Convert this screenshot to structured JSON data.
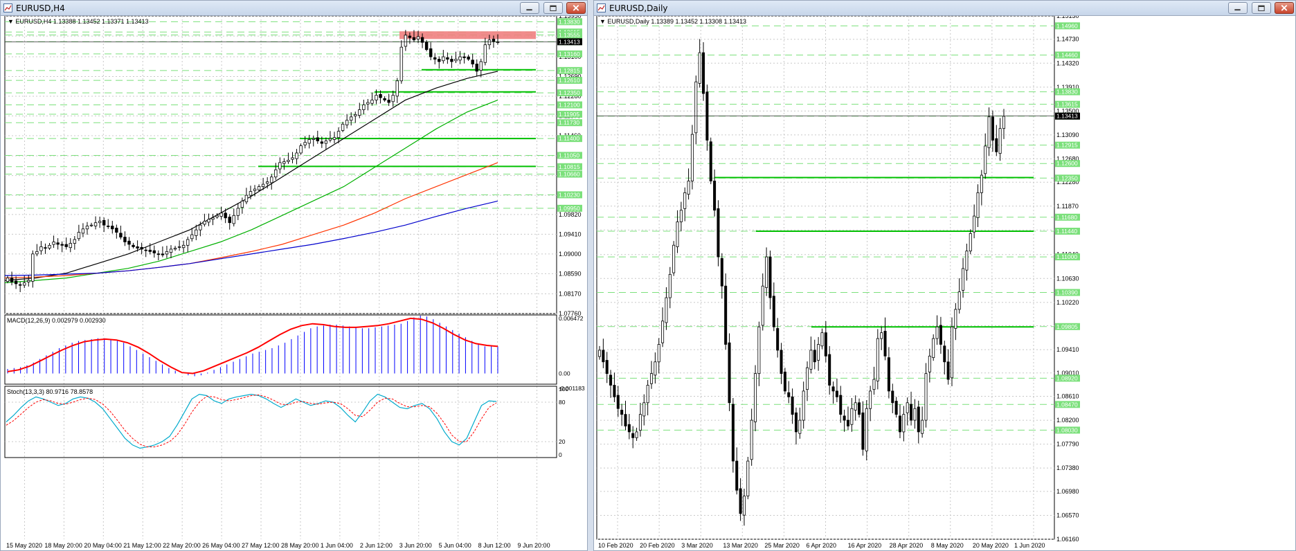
{
  "colors": {
    "background": "#ffffff",
    "grid": "#c8c8c8",
    "candle_border": "#000000",
    "candle_bull": "#ffffff",
    "candle_bear": "#000000",
    "level_lines": "#7be07b",
    "level_labels_bg": "#7be07b",
    "resistance_zone": "#f08080",
    "support_lines": "#00c000",
    "ma_black": "#000000",
    "ma_green": "#00b000",
    "ma_red": "#ff3300",
    "ma_blue": "#0000cc",
    "macd_hist": "#0000ff",
    "macd_signal": "#ff0000",
    "stoch_main": "#00aacc",
    "stoch_signal": "#ff0000",
    "titlebar": "#c7d6ea"
  },
  "windows": [
    {
      "title": "EURUSD,H4",
      "icon": "chart-window-icon",
      "buttons": [
        "minimize-icon",
        "restore-icon",
        "close-icon"
      ]
    },
    {
      "title": "EURUSD,Daily",
      "icon": "chart-window-icon",
      "buttons": [
        "minimize-icon",
        "restore-icon",
        "close-icon"
      ]
    }
  ],
  "chart_data": [
    {
      "type": "candlestick",
      "symbol_header": "EURUSD,H4  1.13388 1.13452 1.13371 1.13413",
      "ylim": [
        1.0776,
        1.1395
      ],
      "price_ticks": [
        "1.13950",
        "1.13530",
        "1.13100",
        "1.12690",
        "1.12280",
        "1.11870",
        "1.11460",
        "1.11040",
        "1.10630",
        "1.10220",
        "1.09820",
        "1.09410",
        "1.09000",
        "1.08590",
        "1.08170",
        "1.07760"
      ],
      "price_ticks_values": [
        1.1395,
        1.1353,
        1.131,
        1.1269,
        1.1228,
        1.1187,
        1.1146,
        1.1104,
        1.1063,
        1.1022,
        1.0982,
        1.0941,
        1.09,
        1.0859,
        1.0817,
        1.0776
      ],
      "level_labels": [
        "1.13830",
        "1.13615",
        "1.13555",
        "1.13413",
        "1.13160",
        "1.12815",
        "1.12610",
        "1.12350",
        "1.12100",
        "1.11905",
        "1.11730",
        "1.11400",
        "1.11050",
        "1.10815",
        "1.10660",
        "1.10230",
        "1.09950"
      ],
      "level_values": [
        1.1383,
        1.13615,
        1.13555,
        1.13413,
        1.1316,
        1.12815,
        1.1261,
        1.1235,
        1.121,
        1.11905,
        1.1173,
        1.114,
        1.1105,
        1.10815,
        1.1066,
        1.1023,
        1.0995
      ],
      "current_price": "1.13413",
      "resistance_zone": [
        1.1347,
        1.1363
      ],
      "support_lines": [
        1.1283,
        1.1237,
        1.114,
        1.1082
      ],
      "x_labels": [
        "15 May 2020",
        "18 May 20:00",
        "20 May 04:00",
        "21 May 12:00",
        "22 May 20:00",
        "26 May 04:00",
        "27 May 12:00",
        "28 May 20:00",
        "1 Jun 04:00",
        "2 Jun 12:00",
        "3 Jun 20:00",
        "5 Jun 04:00",
        "8 Jun 12:00",
        "9 Jun 20:00"
      ],
      "closes": [
        1.085,
        1.0842,
        1.0838,
        1.0835,
        1.084,
        1.0845,
        1.09,
        1.0905,
        1.0915,
        1.0912,
        1.0918,
        1.0925,
        1.092,
        1.0918,
        1.0915,
        1.0922,
        1.093,
        1.0945,
        1.0952,
        1.0958,
        1.096,
        1.0965,
        1.0968,
        1.096,
        1.0958,
        1.0952,
        1.0945,
        1.0935,
        1.0925,
        1.092,
        1.0915,
        1.0912,
        1.091,
        1.0908,
        1.0905,
        1.0902,
        1.09,
        1.0898,
        1.0905,
        1.091,
        1.0912,
        1.0915,
        1.0918,
        1.093,
        1.094,
        1.095,
        1.096,
        1.0968,
        1.0972,
        1.0975,
        1.098,
        1.0985,
        1.0975,
        1.0965,
        1.098,
        1.0995,
        1.101,
        1.1022,
        1.103,
        1.1035,
        1.104,
        1.1045,
        1.105,
        1.106,
        1.1075,
        1.109,
        1.1092,
        1.1095,
        1.11,
        1.111,
        1.1125,
        1.1132,
        1.1138,
        1.114,
        1.1135,
        1.113,
        1.1135,
        1.114,
        1.1142,
        1.1155,
        1.117,
        1.1178,
        1.1185,
        1.119,
        1.12,
        1.121,
        1.1215,
        1.122,
        1.123,
        1.1225,
        1.122,
        1.1215,
        1.123,
        1.126,
        1.133,
        1.1355,
        1.135,
        1.1345,
        1.1352,
        1.134,
        1.1325,
        1.131,
        1.1305,
        1.13,
        1.131,
        1.1305,
        1.13,
        1.1305,
        1.131,
        1.1308,
        1.1305,
        1.1295,
        1.128,
        1.13,
        1.1335,
        1.1345,
        1.1342,
        1.1341
      ],
      "moving_averages": [
        {
          "color": "#000000",
          "values": [
            1.0845,
            1.085,
            1.086,
            1.088,
            1.09,
            1.0925,
            1.095,
            1.0985,
            1.102,
            1.106,
            1.11,
            1.114,
            1.118,
            1.122,
            1.1245,
            1.1265,
            1.128
          ]
        },
        {
          "color": "#00b000",
          "values": [
            1.084,
            1.0845,
            1.085,
            1.086,
            1.087,
            1.0885,
            1.0905,
            1.0925,
            1.095,
            1.098,
            1.101,
            1.104,
            1.108,
            1.112,
            1.116,
            1.1195,
            1.122
          ]
        },
        {
          "color": "#ff3300",
          "values": [
            1.085,
            1.0852,
            1.0855,
            1.086,
            1.0865,
            1.0872,
            1.088,
            1.0892,
            1.0905,
            1.092,
            1.094,
            1.096,
            1.0985,
            1.1015,
            1.104,
            1.1065,
            1.109
          ]
        },
        {
          "color": "#0000cc",
          "values": [
            1.0855,
            1.0856,
            1.0858,
            1.086,
            1.0865,
            1.0872,
            1.088,
            1.089,
            1.09,
            1.091,
            1.092,
            1.0932,
            1.0945,
            1.096,
            1.0978,
            1.0995,
            1.101
          ]
        }
      ],
      "macd": {
        "label": "MACD(12,26,9) 0.002979 0.002930",
        "top_label": "0.006472",
        "zero_label": "0.00",
        "bottom_label": "-0.001183",
        "ylim": [
          -0.001183,
          0.006472
        ],
        "hist": [
          0.0005,
          0.0006,
          0.0007,
          0.0009,
          0.0012,
          0.0016,
          0.002,
          0.0024,
          0.0028,
          0.0031,
          0.0034,
          0.0036,
          0.0037,
          0.0038,
          0.0039,
          0.0039,
          0.0038,
          0.0036,
          0.0034,
          0.003,
          0.0026,
          0.0022,
          0.0018,
          0.0014,
          0.001,
          0.0006,
          0.0003,
          0.0,
          -0.0002,
          -0.0003,
          -0.0002,
          0.0001,
          0.0004,
          0.0007,
          0.001,
          0.0013,
          0.0016,
          0.0019,
          0.0022,
          0.0024,
          0.0026,
          0.0028,
          0.0031,
          0.0034,
          0.0038,
          0.0042,
          0.0046,
          0.005,
          0.0052,
          0.0053,
          0.0054,
          0.0054,
          0.0053,
          0.0052,
          0.0051,
          0.005,
          0.005,
          0.0051,
          0.0052,
          0.0053,
          0.0054,
          0.0055,
          0.0058,
          0.0062,
          0.0064,
          0.0063,
          0.006,
          0.0056,
          0.0052,
          0.0048,
          0.0044,
          0.004,
          0.0036,
          0.0033,
          0.003,
          0.003,
          0.003
        ],
        "signal": [
          0.0002,
          0.0004,
          0.0008,
          0.0014,
          0.002,
          0.0026,
          0.0031,
          0.0035,
          0.0037,
          0.0038,
          0.0037,
          0.0034,
          0.0029,
          0.0022,
          0.0014,
          0.0007,
          0.0001,
          0.0,
          0.0003,
          0.0008,
          0.0013,
          0.0018,
          0.0023,
          0.0029,
          0.0036,
          0.0043,
          0.0049,
          0.0053,
          0.0055,
          0.0054,
          0.0052,
          0.0051,
          0.0051,
          0.0052,
          0.0053,
          0.0055,
          0.0058,
          0.0061,
          0.006,
          0.0056,
          0.005,
          0.0043,
          0.0037,
          0.0033,
          0.0031,
          0.003
        ]
      },
      "stoch": {
        "label": "Stoch(13,3,3) 80.9716 78.8578",
        "levels": [
          "100",
          "80",
          "20",
          "0"
        ],
        "ylim": [
          0,
          100
        ],
        "main": [
          50,
          60,
          72,
          82,
          88,
          85,
          80,
          75,
          78,
          85,
          88,
          86,
          80,
          70,
          55,
          40,
          25,
          15,
          10,
          12,
          15,
          20,
          28,
          45,
          65,
          85,
          92,
          90,
          82,
          78,
          85,
          88,
          90,
          92,
          90,
          85,
          78,
          72,
          78,
          85,
          80,
          75,
          78,
          82,
          80,
          72,
          60,
          50,
          65,
          82,
          92,
          88,
          80,
          72,
          70,
          75,
          78,
          70,
          55,
          35,
          20,
          15,
          25,
          50,
          75,
          82,
          81
        ],
        "signal": [
          45,
          52,
          62,
          72,
          80,
          84,
          82,
          78,
          77,
          80,
          84,
          86,
          84,
          77,
          66,
          52,
          37,
          25,
          16,
          12,
          12,
          15,
          20,
          30,
          46,
          65,
          80,
          89,
          88,
          84,
          82,
          84,
          87,
          90,
          91,
          88,
          83,
          77,
          76,
          80,
          81,
          78,
          77,
          79,
          80,
          78,
          70,
          60,
          58,
          68,
          80,
          86,
          85,
          78,
          73,
          73,
          75,
          73,
          63,
          48,
          30,
          20,
          20,
          35,
          55,
          72,
          79
        ]
      }
    },
    {
      "type": "candlestick",
      "symbol_header": "EURUSD,Daily  1.13389 1.13452 1.13308 1.13413",
      "ylim": [
        1.0616,
        1.1513
      ],
      "price_ticks": [
        "1.15130",
        "1.14730",
        "1.14320",
        "1.13910",
        "1.13500",
        "1.13090",
        "1.12680",
        "1.12280",
        "1.11870",
        "1.11460",
        "1.11040",
        "1.10630",
        "1.10220",
        "1.09820",
        "1.09410",
        "1.09010",
        "1.08610",
        "1.08200",
        "1.07790",
        "1.07380",
        "1.06980",
        "1.06570",
        "1.06160"
      ],
      "price_ticks_values": [
        1.1513,
        1.1473,
        1.1432,
        1.1391,
        1.135,
        1.1309,
        1.1268,
        1.1228,
        1.1187,
        1.1146,
        1.1104,
        1.1063,
        1.1022,
        1.0982,
        1.0941,
        1.0901,
        1.0861,
        1.082,
        1.0779,
        1.0738,
        1.0698,
        1.0657,
        1.0616
      ],
      "level_labels": [
        "1.14960",
        "1.14460",
        "1.13830",
        "1.13615",
        "1.13413",
        "1.12915",
        "1.12600",
        "1.12350",
        "1.11680",
        "1.11440",
        "1.11000",
        "1.10390",
        "1.09805",
        "1.08920",
        "1.08470",
        "1.08030"
      ],
      "level_values": [
        1.1496,
        1.1446,
        1.1383,
        1.13615,
        1.13413,
        1.12915,
        1.126,
        1.1235,
        1.1168,
        1.1144,
        1.11,
        1.1039,
        1.09805,
        1.0892,
        1.0847,
        1.0803
      ],
      "current_price": "1.13413",
      "support_lines": [
        1.1236,
        1.1144,
        1.098
      ],
      "x_labels": [
        "10 Feb 2020",
        "20 Feb 2020",
        "3 Mar 2020",
        "13 Mar 2020",
        "25 Mar 2020",
        "6 Apr 2020",
        "16 Apr 2020",
        "28 Apr 2020",
        "8 May 2020",
        "20 May 2020",
        "1 Jun 2020"
      ],
      "closes": [
        1.094,
        1.092,
        1.09,
        1.088,
        1.086,
        1.084,
        1.083,
        1.081,
        1.08,
        1.079,
        1.08,
        1.083,
        1.085,
        1.088,
        1.09,
        1.092,
        1.095,
        1.099,
        1.103,
        1.107,
        1.112,
        1.116,
        1.118,
        1.121,
        1.123,
        1.131,
        1.14,
        1.145,
        1.138,
        1.13,
        1.123,
        1.118,
        1.11,
        1.105,
        1.095,
        1.085,
        1.075,
        1.07,
        1.066,
        1.069,
        1.075,
        1.082,
        1.09,
        1.098,
        1.105,
        1.11,
        1.103,
        1.098,
        1.094,
        1.09,
        1.087,
        1.086,
        1.083,
        1.08,
        1.082,
        1.087,
        1.091,
        1.094,
        1.092,
        1.095,
        1.097,
        1.093,
        1.088,
        1.087,
        1.086,
        1.083,
        1.082,
        1.081,
        1.084,
        1.085,
        1.083,
        1.077,
        1.084,
        1.087,
        1.089,
        1.096,
        1.097,
        1.093,
        1.087,
        1.085,
        1.083,
        1.08,
        1.083,
        1.085,
        1.082,
        1.084,
        1.08,
        1.082,
        1.09,
        1.093,
        1.096,
        1.098,
        1.095,
        1.092,
        1.089,
        1.098,
        1.101,
        1.104,
        1.108,
        1.111,
        1.114,
        1.117,
        1.121,
        1.124,
        1.129,
        1.134,
        1.13,
        1.128,
        1.132,
        1.1341
      ]
    }
  ]
}
